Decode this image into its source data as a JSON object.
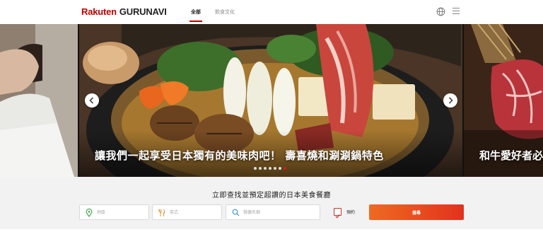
{
  "header": {
    "logo_brand": "Rakuten",
    "logo_product": "GURUNAVI",
    "tabs": [
      {
        "label": "全部",
        "active": true
      },
      {
        "label": "飲食文化",
        "active": false
      }
    ],
    "icons": [
      "globe-icon",
      "menu-icon"
    ]
  },
  "carousel": {
    "slides": [
      {
        "caption": ""
      },
      {
        "caption": "讓我們一起享受日本獨有的美味肉吧！ 壽喜燒和涮涮鍋特色"
      },
      {
        "caption": "和牛愛好者必"
      }
    ],
    "dot_count": 7,
    "active_dot": 6,
    "icons": [
      "chevron-left-icon",
      "chevron-right-icon"
    ]
  },
  "search": {
    "title": "立即查找並預定超讚的日本美食餐廳",
    "location_placeholder": "地區",
    "cuisine_placeholder": "菜式",
    "keyword_placeholder": "餐廳名稱",
    "reserve_label": "預約",
    "submit_label": "搜尋",
    "icons": [
      "location-pin-icon",
      "fork-knife-icon",
      "search-icon"
    ]
  },
  "colors": {
    "brand_red": "#bf0000",
    "button_orange": "#ee6a22",
    "button_red": "#e2321d",
    "active_dot": "#d61c1c"
  }
}
